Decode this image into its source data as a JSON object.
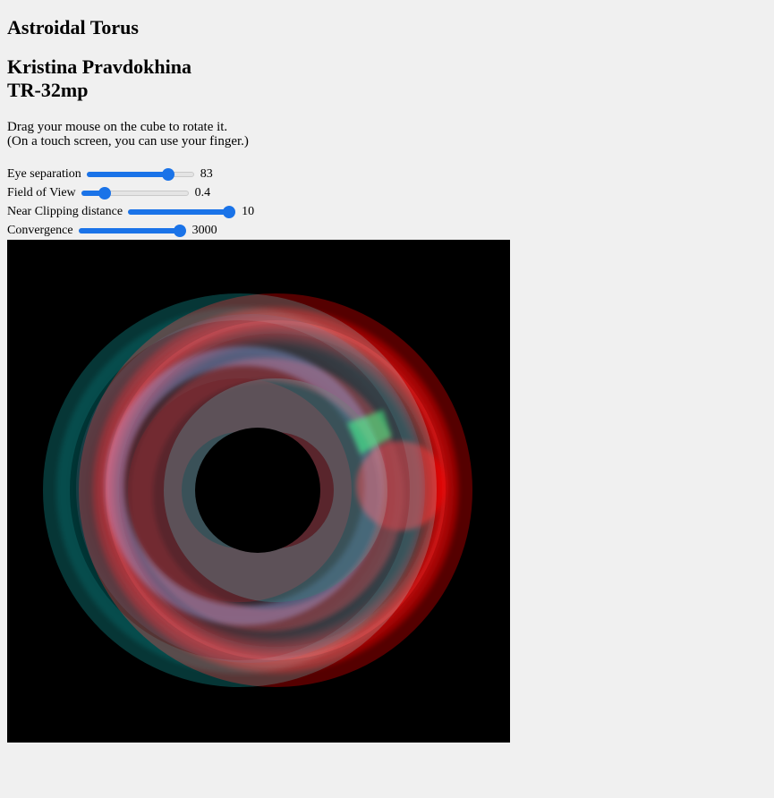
{
  "page": {
    "title": "Astroidal Torus",
    "author": "Kristina Pravdokhina",
    "group": "TR-32mp",
    "instructions": [
      "Drag your mouse on the cube to rotate it.",
      "(On a touch screen, you can use your finger.)"
    ]
  },
  "controls": {
    "eye_separation": {
      "label": "Eye separation",
      "value": "83",
      "fraction": 0.79
    },
    "field_of_view": {
      "label": "Field of View",
      "value": "0.4",
      "fraction": 0.18
    },
    "near_clipping": {
      "label": "Near Clipping distance",
      "value": "10",
      "fraction": 1.0
    },
    "convergence": {
      "label": "Convergence",
      "value": "3000",
      "fraction": 1.0
    }
  },
  "colors": {
    "accent": "#1a73e8",
    "left_eye": "#ff0000",
    "right_eye": "#00ffff",
    "canvas_bg": "#000000"
  }
}
